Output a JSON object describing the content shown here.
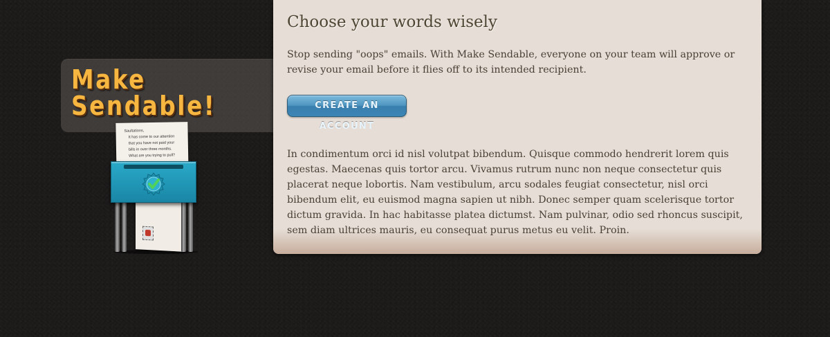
{
  "logo": {
    "line1": "Make",
    "line2": "Sendable!",
    "color": "#f6b640"
  },
  "illustration": {
    "icon": "mailbox-icon",
    "letter_lines": [
      "Saultations,",
      "It has come to our attention",
      "that you have not paid your",
      "bills in over three months.",
      "What are you trying to pull?"
    ]
  },
  "content": {
    "heading": "Choose your words wisely",
    "intro": "Stop sending \"oops\" emails. With Make Sendable, everyone on your team will approve or revise your email before it flies off to its intended recipient.",
    "cta_label": "CREATE AN ACCOUNT",
    "body": "In condimentum orci id nisl volutpat bibendum. Quisque commodo hendrerit lorem quis egestas. Maecenas quis tortor arcu. Vivamus rutrum nunc non neque consectetur quis placerat neque lobortis. Nam vestibulum, arcu sodales feugiat consectetur, nisl orci bibendum elit, eu euismod magna sapien ut nibh. Donec semper quam scelerisque tortor dictum gravida. In hac habitasse platea dictumst. Nam pulvinar, odio sed rhoncus suscipit, sem diam ultrices mauris, eu consequat purus metus eu velit. Proin."
  },
  "colors": {
    "background": "#1c1b1a",
    "panel": "#e6ded6",
    "button": "#4f95c0",
    "heading": "#4e4533"
  }
}
